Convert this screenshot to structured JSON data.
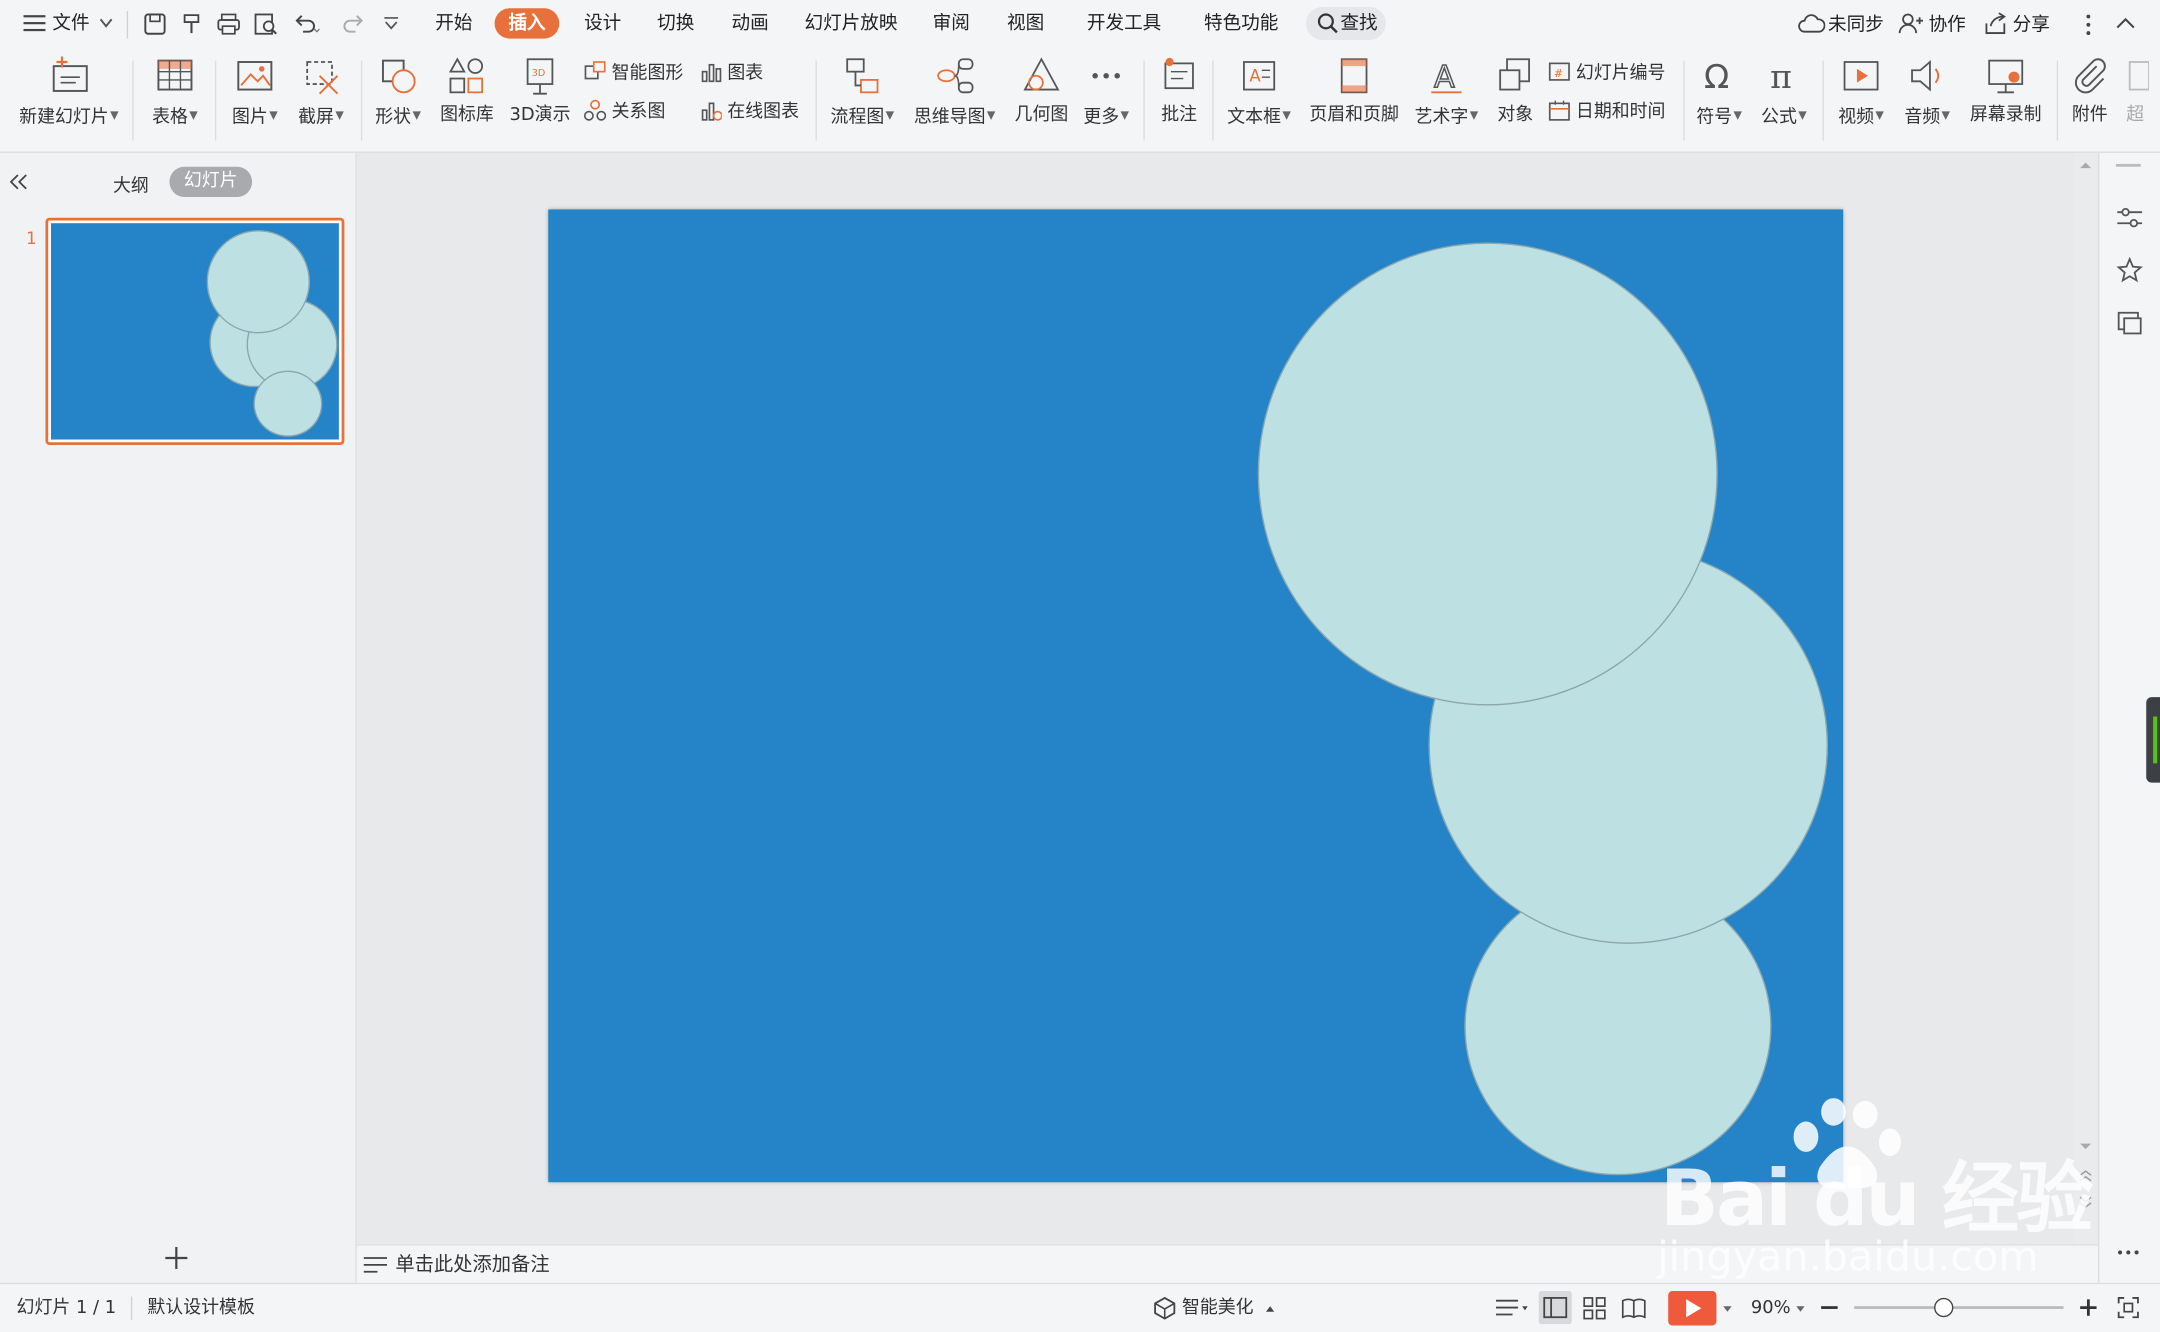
{
  "title_menu": {
    "file": "文件"
  },
  "tabs": [
    "开始",
    "插入",
    "设计",
    "切换",
    "动画",
    "幻灯片放映",
    "审阅",
    "视图",
    "开发工具",
    "特色功能"
  ],
  "active_tab": "插入",
  "search_label": "查找",
  "top_right": {
    "sync": "未同步",
    "collab": "协作",
    "share": "分享"
  },
  "ribbon": {
    "new_slide": "新建幻灯片",
    "table": "表格",
    "picture": "图片",
    "screenshot": "截屏",
    "shape": "形状",
    "icon_lib": "图标库",
    "demo3d": "3D演示",
    "smart_art": "智能图形",
    "relation": "关系图",
    "chart": "图表",
    "online_chart": "在线图表",
    "flowchart": "流程图",
    "mindmap": "思维导图",
    "geometry": "几何图",
    "more": "更多",
    "comment": "批注",
    "textbox": "文本框",
    "header_footer": "页眉和页脚",
    "wordart": "艺术字",
    "object": "对象",
    "slide_number": "幻灯片编号",
    "datetime": "日期和时间",
    "symbol": "符号",
    "formula": "公式",
    "video": "视频",
    "audio": "音频",
    "screen_record": "屏幕录制",
    "attachment": "附件",
    "overflow": "超"
  },
  "left_panel": {
    "outline_tab": "大纲",
    "slides_tab": "幻灯片",
    "slide_index": "1"
  },
  "notes_placeholder": "单击此处添加备注",
  "status": {
    "slide_counter": "幻灯片 1 / 1",
    "template": "默认设计模板",
    "beautify": "智能美化",
    "zoom": "90%"
  },
  "colors": {
    "accent": "#e8703a",
    "slide_bg": "#2584c8",
    "circle_fill": "#bde1e3"
  },
  "watermark": {
    "logo": "Bai du 经验",
    "url": "jingyan.baidu.com"
  }
}
